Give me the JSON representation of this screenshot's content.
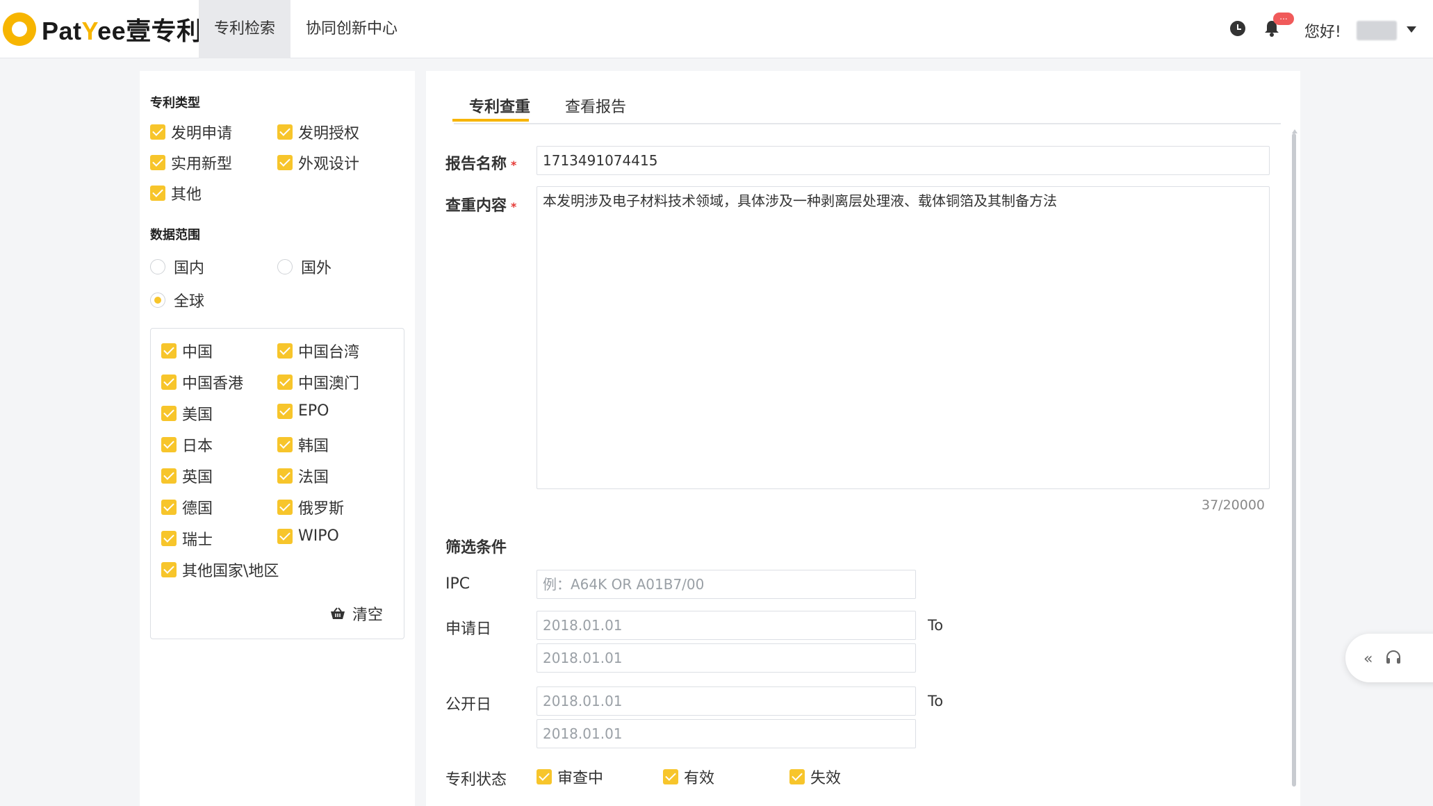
{
  "header": {
    "logo_text_a": "Pat",
    "logo_text_y": "Y",
    "logo_text_b": "ee壹专利",
    "nav": [
      {
        "label": "专利检索",
        "active": true
      },
      {
        "label": "协同创新中心",
        "active": false
      }
    ],
    "notification_badge": "...",
    "greeting": "您好!"
  },
  "filters": {
    "patent_type_title": "专利类型",
    "patent_types": [
      "发明申请",
      "发明授权",
      "实用新型",
      "外观设计",
      "其他"
    ],
    "data_range_title": "数据范围",
    "ranges": [
      {
        "label": "国内",
        "checked": false
      },
      {
        "label": "国外",
        "checked": false
      },
      {
        "label": "全球",
        "checked": true
      }
    ],
    "countries": [
      "中国",
      "中国台湾",
      "中国香港",
      "中国澳门",
      "美国",
      "EPO",
      "日本",
      "韩国",
      "英国",
      "法国",
      "德国",
      "俄罗斯",
      "瑞士",
      "WIPO",
      "其他国家\\地区"
    ],
    "clear_label": "清空"
  },
  "main": {
    "tabs": [
      {
        "label": "专利查重",
        "active": true
      },
      {
        "label": "查看报告",
        "active": false
      }
    ],
    "report_name_label": "报告名称",
    "report_name_value": "1713491074415",
    "content_label": "查重内容",
    "content_value": "本发明涉及电子材料技术领域，具体涉及一种剥离层处理液、载体铜箔及其制备方法",
    "char_counter": "37/20000",
    "filter_title": "筛选条件",
    "ipc_label": "IPC",
    "ipc_placeholder": "例：A64K OR A01B7/00",
    "apply_date_label": "申请日",
    "apply_date_from": "2018.01.01",
    "apply_date_to": "2018.01.01",
    "publish_date_label": "公开日",
    "publish_date_from": "2018.01.01",
    "publish_date_to": "2018.01.01",
    "to_label": "To",
    "status_label": "专利状态",
    "statuses": [
      "审查中",
      "有效",
      "失效"
    ]
  },
  "colors": {
    "accent": "#f7b500",
    "checkbox": "#f7c52b",
    "required": "#e53935"
  }
}
